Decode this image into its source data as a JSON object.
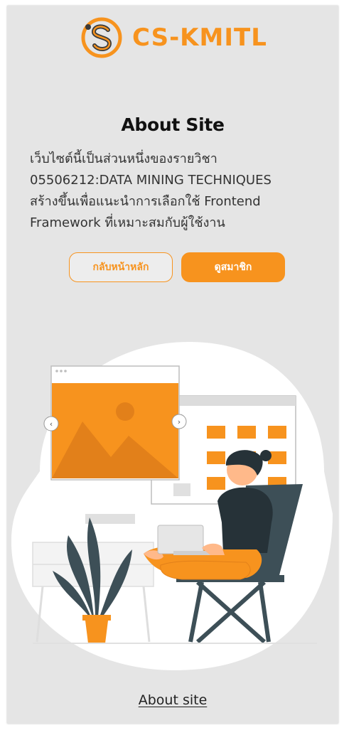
{
  "brand": {
    "name": "CS-KMITL",
    "accent": "#f7931e"
  },
  "about": {
    "title": "About Site",
    "lines": [
      "เว็บไซต์นี้เป็นส่วนหนึ่งของรายวิชา",
      "05506212:DATA MINING TECHNIQUES",
      "สร้างขึ้นเพื่อแนะนำการเลือกใช้ Frontend",
      "Framework ที่เหมาะสมกับผู้ใช้งาน"
    ]
  },
  "buttons": {
    "home": "กลับหน้าหลัก",
    "members": "ดูสมาชิก"
  },
  "illustration": {
    "icons": [
      "chevron-left-icon",
      "chevron-right-icon"
    ]
  },
  "footer": {
    "link": "About site"
  }
}
